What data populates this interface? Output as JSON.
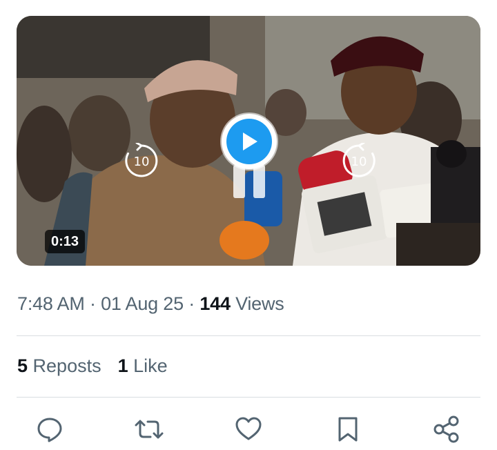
{
  "video": {
    "duration": "0:13",
    "skip_back_seconds": "10",
    "skip_forward_seconds": "10",
    "accent_color": "#1d9bf0"
  },
  "meta": {
    "time": "7:48 AM",
    "separator": " · ",
    "date": "01 Aug 25",
    "views_count": "144",
    "views_label": " Views"
  },
  "stats": {
    "reposts_count": "5",
    "reposts_label": " Reposts",
    "likes_count": "1",
    "likes_label": " Like"
  },
  "actions": [
    {
      "icon": "reply-icon"
    },
    {
      "icon": "repost-icon"
    },
    {
      "icon": "like-icon"
    },
    {
      "icon": "bookmark-icon"
    },
    {
      "icon": "share-icon"
    }
  ],
  "colors": {
    "text_primary": "#0f1419",
    "text_secondary": "#536471",
    "divider": "#d9dde1"
  }
}
